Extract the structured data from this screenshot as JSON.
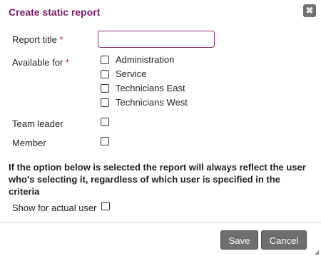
{
  "dialog": {
    "title": "Create static report",
    "close_symbol": "✖"
  },
  "form": {
    "report_title_label": "Report title",
    "report_title_value": "",
    "required_mark": "*",
    "available_for_label": "Available for",
    "available_options": [
      {
        "label": "Administration",
        "checked": false
      },
      {
        "label": "Service",
        "checked": false
      },
      {
        "label": "Technicians East",
        "checked": false
      },
      {
        "label": "Technicians West",
        "checked": false
      }
    ],
    "team_leader_label": "Team leader",
    "member_label": "Member",
    "note": "If the option below is selected the report will always reflect the user who's selecting it, regardless of which user is specified in the criteria",
    "show_for_actual_user_label": "Show for actual user"
  },
  "footer": {
    "save_label": "Save",
    "cancel_label": "Cancel"
  }
}
